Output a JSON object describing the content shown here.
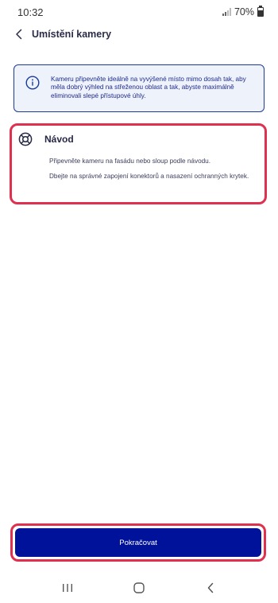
{
  "status_bar": {
    "time": "10:32",
    "battery_text": "70%",
    "icons": [
      "signal-icon",
      "battery-icon"
    ]
  },
  "header": {
    "back_icon": "chevron-left-icon",
    "title": "Umístění kamery"
  },
  "info_card": {
    "icon": "info-icon",
    "text": "Kameru připevněte ideálně na vyvýšené místo mimo dosah tak, aby měla dobrý výhled na střeženou oblast a tak, abyste maximálně eliminovali slepé přístupové úhly."
  },
  "guide_card": {
    "icon": "lifebuoy-icon",
    "title": "Návod",
    "paragraphs": [
      "Připevněte kameru na fasádu nebo sloup podle návodu.",
      "Dbejte na správné zapojení konektorů a nasazení ochranných krytek."
    ]
  },
  "footer": {
    "continue_label": "Pokračovat"
  },
  "nav_bar": {
    "icons": [
      "recent-apps-icon",
      "home-icon",
      "back-icon"
    ]
  },
  "colors": {
    "accent": "#00129a",
    "highlight": "#e0304f",
    "info_bg": "#eef3fb",
    "info_border": "#1d3a9a"
  }
}
